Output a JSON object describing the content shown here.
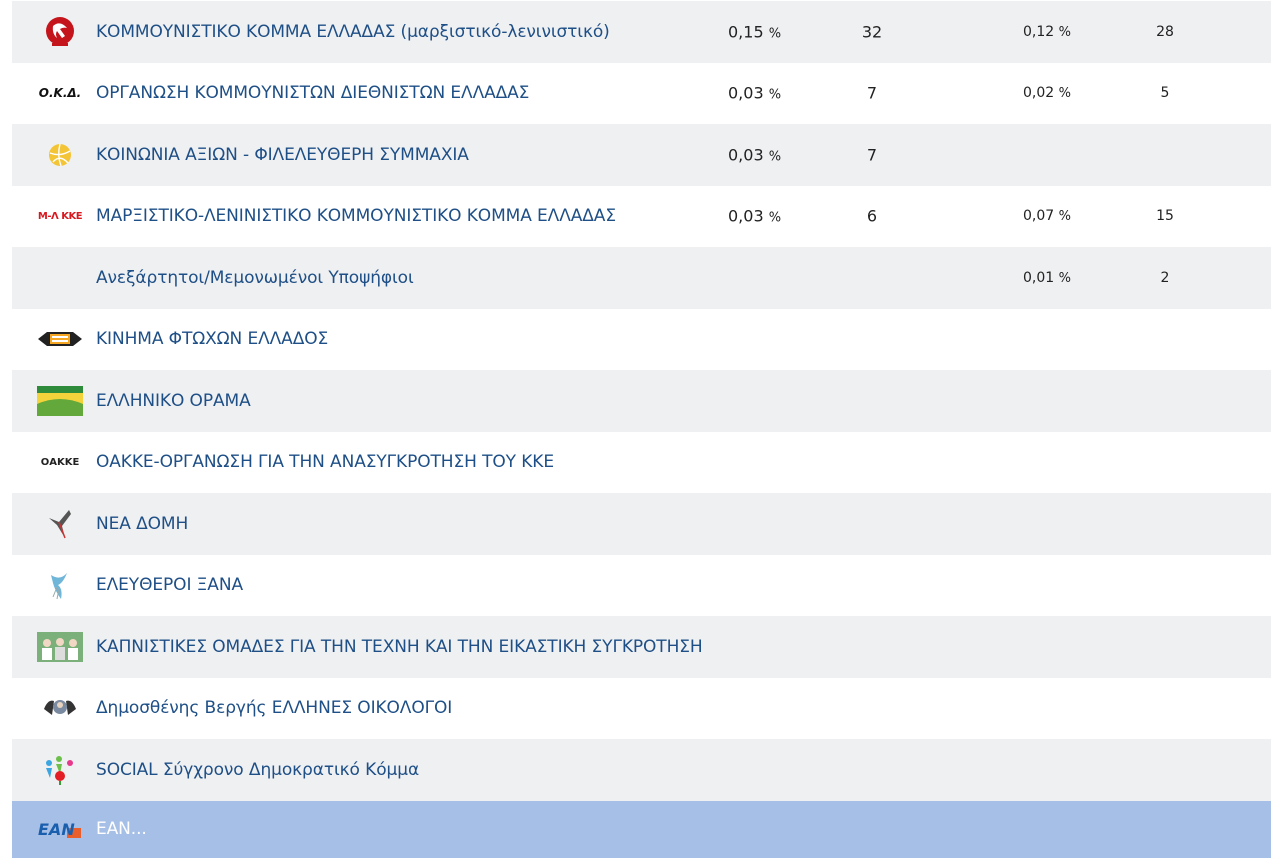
{
  "rows": [
    {
      "logo": "kke-ml-hammer-sickle-icon",
      "name": "ΚΟΜΜΟΥΝΙΣΤΙΚΟ ΚΟΜΜΑ ΕΛΛΑΔΑΣ (μαρξιστικό-λενινιστικό)",
      "pct1": "0,15",
      "cnt1": "32",
      "pct2": "0,12",
      "cnt2": "28"
    },
    {
      "logo": "okd-text-logo",
      "logo_text": "Ο.Κ.Δ.",
      "name": "ΟΡΓΑΝΩΣΗ ΚΟΜΜΟΥΝΙΣΤΩΝ ΔΙΕΘΝΙΣΤΩΝ ΕΛΛΑΔΑΣ",
      "pct1": "0,03",
      "cnt1": "7",
      "pct2": "0,02",
      "cnt2": "5"
    },
    {
      "logo": "yellow-ball-icon",
      "name": "ΚΟΙΝΩΝΙΑ ΑΞΙΩΝ - ΦΙΛΕΛΕΥΘΕΡΗ ΣΥΜΜΑΧΙΑ",
      "pct1": "0,03",
      "cnt1": "7",
      "pct2": "",
      "cnt2": ""
    },
    {
      "logo": "m-l-kke-text-logo",
      "logo_text": "Μ-Λ ΚΚΕ",
      "name": "ΜΑΡΞΙΣΤΙΚΟ-ΛΕΝΙΝΙΣΤΙΚΟ ΚΟΜΜΟΥΝΙΣΤΙΚΟ ΚΟΜΜΑ ΕΛΛΑΔΑΣ",
      "pct1": "0,03",
      "cnt1": "6",
      "pct2": "0,07",
      "cnt2": "15"
    },
    {
      "logo": "",
      "name": "Ανεξάρτητοι/Μεμονωμένοι Υποψήφιοι",
      "pct1": "",
      "cnt1": "",
      "pct2": "0,01",
      "cnt2": "2"
    },
    {
      "logo": "kinima-ftoxon-banner-icon",
      "name": "ΚΙΝΗΜΑ ΦΤΩΧΩΝ ΕΛΛΑΔΟΣ",
      "pct1": "",
      "cnt1": "",
      "pct2": "",
      "cnt2": ""
    },
    {
      "logo": "elliniko-orama-landscape-icon",
      "name": "ΕΛΛΗΝΙΚΟ ΟΡΑΜΑ",
      "pct1": "",
      "cnt1": "",
      "pct2": "",
      "cnt2": ""
    },
    {
      "logo": "oakke-text-logo",
      "logo_text": "ΟΑΚΚΕ",
      "name": "ΟΑΚΚΕ-ΟΡΓΑΝΩΣΗ ΓΙΑ ΤΗΝ ΑΝΑΣΥΓΚΡΟΤΗΣΗ ΤΟΥ ΚΚΕ",
      "pct1": "",
      "cnt1": "",
      "pct2": "",
      "cnt2": ""
    },
    {
      "logo": "swallow-bird-icon",
      "name": "ΝΕΑ ΔΟΜΗ",
      "pct1": "",
      "cnt1": "",
      "pct2": "",
      "cnt2": ""
    },
    {
      "logo": "dove-icon",
      "name": "ΕΛΕΥΘΕΡΟΙ ΞΑΝΑ",
      "pct1": "",
      "cnt1": "",
      "pct2": "",
      "cnt2": ""
    },
    {
      "logo": "group-photo-icon",
      "name": "ΚΑΠΝΙΣΤΙΚΕΣ ΟΜΑΔΕΣ ΓΙΑ ΤΗΝ ΤΕΧΝΗ ΚΑΙ ΤΗΝ ΕΙΚΑΣΤΙΚΗ ΣΥΓΚΡΟΤΗΣΗ",
      "pct1": "",
      "cnt1": "",
      "pct2": "",
      "cnt2": ""
    },
    {
      "logo": "portrait-hands-icon",
      "name": "Δημοσθένης Βεργής ΕΛΛΗΝΕΣ ΟΙΚΟΛΟΓΟΙ",
      "pct1": "",
      "cnt1": "",
      "pct2": "",
      "cnt2": ""
    },
    {
      "logo": "social-people-rose-icon",
      "name": "SOCIAL Σύγχρονο Δημοκρατικό Κόμμα",
      "pct1": "",
      "cnt1": "",
      "pct2": "",
      "cnt2": ""
    },
    {
      "logo": "ean-text-logo",
      "logo_text": "ΕΑΝ",
      "name": "ΕΑΝ...",
      "pct1": "",
      "cnt1": "",
      "pct2": "",
      "cnt2": ""
    }
  ],
  "percent_unit": "%",
  "colors": {
    "row_odd": "#eff0f2",
    "row_even": "#ffffff",
    "row_highlight": "#a6bfe6",
    "party_name": "#1e4f86"
  }
}
